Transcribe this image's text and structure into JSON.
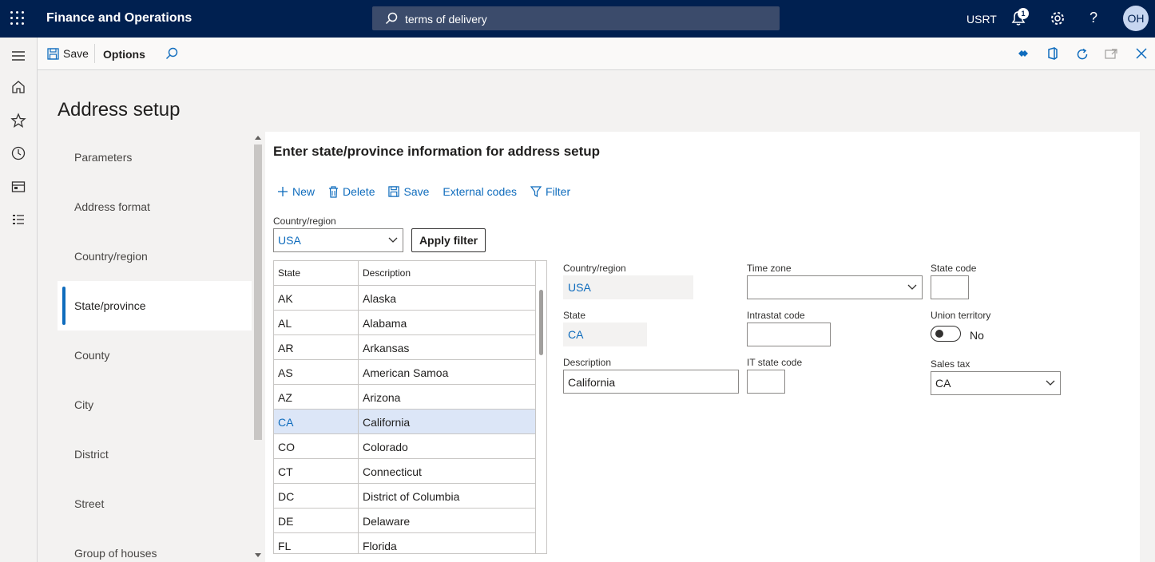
{
  "topbar": {
    "app_title": "Finance and Operations",
    "search_text": "terms of delivery",
    "company": "USRT",
    "notification_count": "1",
    "help_glyph": "?",
    "avatar_initials": "OH"
  },
  "actionpane": {
    "save_label": "Save",
    "options_label": "Options"
  },
  "page": {
    "title": "Address setup"
  },
  "nav": {
    "items": [
      {
        "label": "Parameters"
      },
      {
        "label": "Address format"
      },
      {
        "label": "Country/region"
      },
      {
        "label": "State/province"
      },
      {
        "label": "County"
      },
      {
        "label": "City"
      },
      {
        "label": "District"
      },
      {
        "label": "Street"
      },
      {
        "label": "Group of houses"
      }
    ],
    "active_index": 3
  },
  "panel": {
    "title": "Enter state/province information for address setup",
    "toolbar": {
      "new": "New",
      "delete": "Delete",
      "save": "Save",
      "external_codes": "External codes",
      "filter": "Filter"
    },
    "filter": {
      "label": "Country/region",
      "value": "USA",
      "apply_label": "Apply filter"
    },
    "grid": {
      "headers": [
        "State",
        "Description"
      ],
      "rows": [
        [
          "AK",
          "Alaska"
        ],
        [
          "AL",
          "Alabama"
        ],
        [
          "AR",
          "Arkansas"
        ],
        [
          "AS",
          "American Samoa"
        ],
        [
          "AZ",
          "Arizona"
        ],
        [
          "CA",
          "California"
        ],
        [
          "CO",
          "Colorado"
        ],
        [
          "CT",
          "Connecticut"
        ],
        [
          "DC",
          "District of Columbia"
        ],
        [
          "DE",
          "Delaware"
        ],
        [
          "FL",
          "Florida"
        ]
      ],
      "selected_index": 5
    },
    "details": {
      "country_label": "Country/region",
      "country_value": "USA",
      "state_label": "State",
      "state_value": "CA",
      "description_label": "Description",
      "description_value": "California",
      "timezone_label": "Time zone",
      "timezone_value": "",
      "intrastat_label": "Intrastat code",
      "intrastat_value": "",
      "it_state_label": "IT state code",
      "it_state_value": "",
      "state_code_label": "State code",
      "state_code_value": "",
      "union_label": "Union territory",
      "union_value": "No",
      "sales_tax_label": "Sales tax",
      "sales_tax_value": "CA"
    }
  },
  "colors": {
    "nav_bar": "#002050",
    "accent": "#0f6cbd",
    "selected_row": "#dce6f7"
  }
}
